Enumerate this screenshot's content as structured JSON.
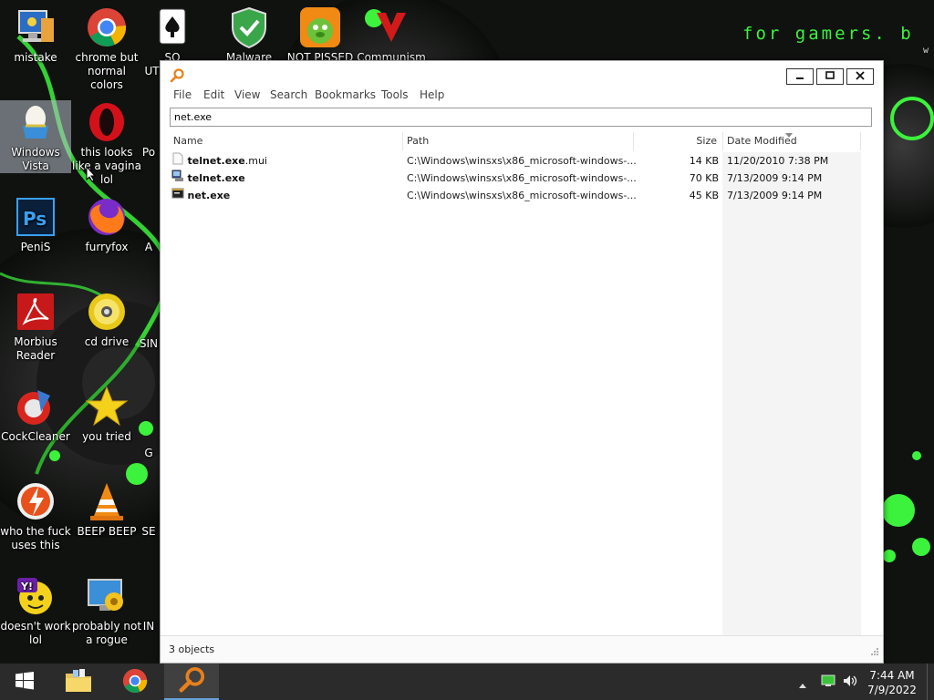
{
  "desktop": {
    "wallpaper_text": "for gamers. b",
    "wallpaper_text2": "w",
    "icons": [
      {
        "label": "mistake",
        "icon": "computer-icon"
      },
      {
        "label": "chrome but normal colors",
        "icon": "chrome-icon"
      },
      {
        "label": "SO UTILLAIRE",
        "icon": "solitaire-icon"
      },
      {
        "label": "Malware",
        "icon": "shield-icon"
      },
      {
        "label": "NOT PISSED",
        "icon": "angry-birds-icon"
      },
      {
        "label": "Communism",
        "icon": "red-logo-icon"
      },
      {
        "label": "Windows Vista",
        "icon": "egg-icon"
      },
      {
        "label": "this looks like a vagina lol",
        "icon": "opera-icon"
      },
      {
        "label": "Po",
        "icon": "partial-icon"
      },
      {
        "label": "PeniS",
        "icon": "photoshop-icon"
      },
      {
        "label": "furryfox",
        "icon": "firefox-icon"
      },
      {
        "label": "A",
        "icon": "partial-icon"
      },
      {
        "label": "Morbius Reader",
        "icon": "acrobat-icon"
      },
      {
        "label": "cd drive",
        "icon": "cd-icon"
      },
      {
        "label": "SIN",
        "icon": "partial-icon"
      },
      {
        "label": "CockCleaner",
        "icon": "ccleaner-icon"
      },
      {
        "label": "you tried",
        "icon": "star-icon"
      },
      {
        "label": "G",
        "icon": "partial-icon"
      },
      {
        "label": "who the fuck uses this",
        "icon": "winamp-icon"
      },
      {
        "label": "BEEP BEEP",
        "icon": "vlc-icon"
      },
      {
        "label": "SE",
        "icon": "partial-icon"
      },
      {
        "label": "doesn't work lol",
        "icon": "yahoo-icon"
      },
      {
        "label": "probably not a rogue",
        "icon": "settings-monitor-icon"
      },
      {
        "label": "IN",
        "icon": "partial-icon"
      }
    ]
  },
  "window": {
    "app_icon": "magnifier-icon",
    "controls": {
      "minimize": "minimize-icon",
      "maximize": "maximize-icon",
      "close": "close-icon"
    },
    "menu": [
      "File",
      "Edit",
      "View",
      "Search",
      "Bookmarks",
      "Tools",
      "Help"
    ],
    "search_value": "net.exe",
    "columns": [
      "Name",
      "Path",
      "Size",
      "Date Modified"
    ],
    "rows": [
      {
        "name": "telnet.exe",
        "name_suffix": ".mui",
        "path": "C:\\Windows\\winsxs\\x86_microsoft-windows-...",
        "size": "14 KB",
        "date": "11/20/2010 7:38 PM",
        "icon": "file-icon"
      },
      {
        "name": "telnet.exe",
        "name_suffix": "",
        "path": "C:\\Windows\\winsxs\\x86_microsoft-windows-...",
        "size": "70 KB",
        "date": "7/13/2009 9:14 PM",
        "icon": "terminal-icon"
      },
      {
        "name": "net.exe",
        "name_suffix": "",
        "path": "C:\\Windows\\winsxs\\x86_microsoft-windows-...",
        "size": "45 KB",
        "date": "7/13/2009 9:14 PM",
        "icon": "console-icon"
      }
    ],
    "status": "3 objects"
  },
  "taskbar": {
    "items": [
      "windows-start-icon",
      "file-explorer-icon",
      "chrome-icon",
      "magnifier-icon"
    ],
    "tray": [
      "show-hidden-icons-icon",
      "network-icon",
      "volume-icon"
    ],
    "time": "7:44 AM",
    "date": "7/9/2022"
  },
  "colors": {
    "wallpaper_green": "#3cf23c",
    "taskbar": "#2b2b2b",
    "active_underline": "#6aa2dc",
    "search_accent": "#e8801c"
  }
}
